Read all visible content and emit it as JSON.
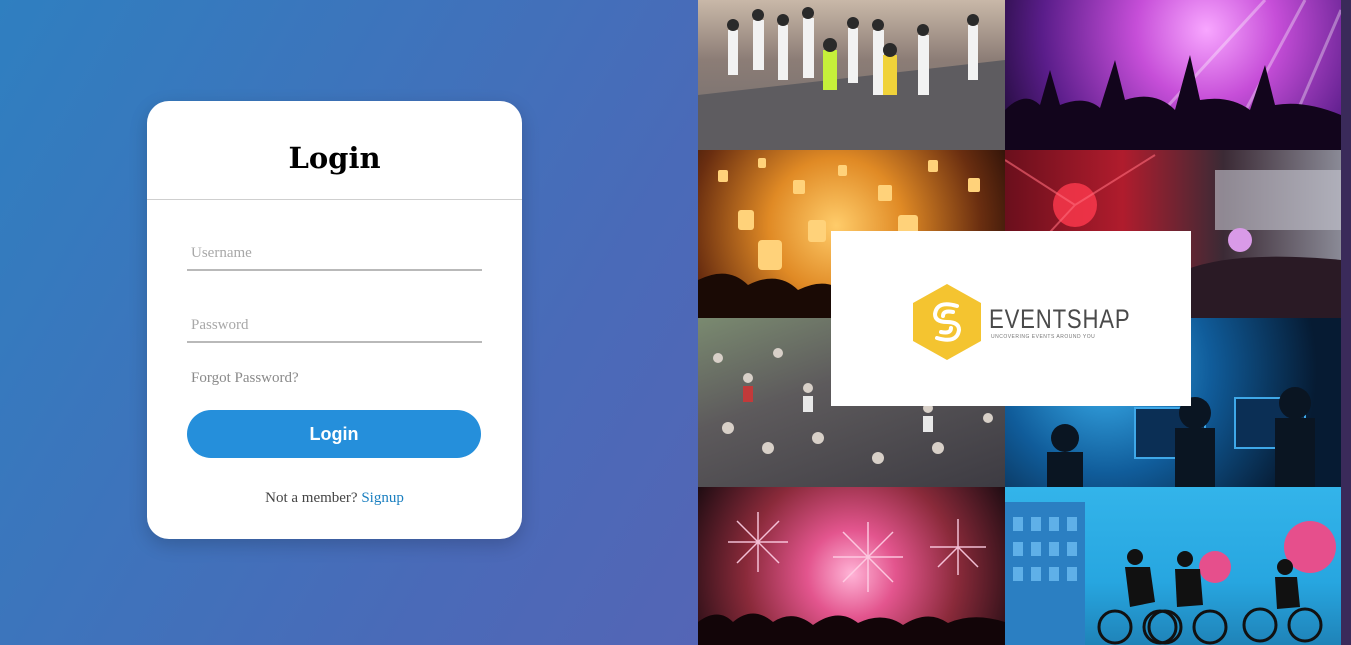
{
  "login": {
    "title": "Login",
    "username_placeholder": "Username",
    "password_placeholder": "Password",
    "forgot_password": "Forgot Password?",
    "login_button": "Login",
    "not_member_text": "Not a member?",
    "signup_link": "Signup"
  },
  "brand": {
    "name": "EVENTSHAP",
    "tagline": "UNCOVERING EVENTS AROUND YOU",
    "accent_color": "#f4c430"
  },
  "colors": {
    "primary_button": "#258fdb",
    "link": "#1a7fc0"
  },
  "collage": {
    "tiles": [
      "marathon-photo",
      "concert-photo",
      "lantern-festival-photo",
      "stage-show-photo",
      "flash-mob-photo",
      "gaming-event-photo",
      "fireworks-photo",
      "cycling-illustration"
    ]
  }
}
